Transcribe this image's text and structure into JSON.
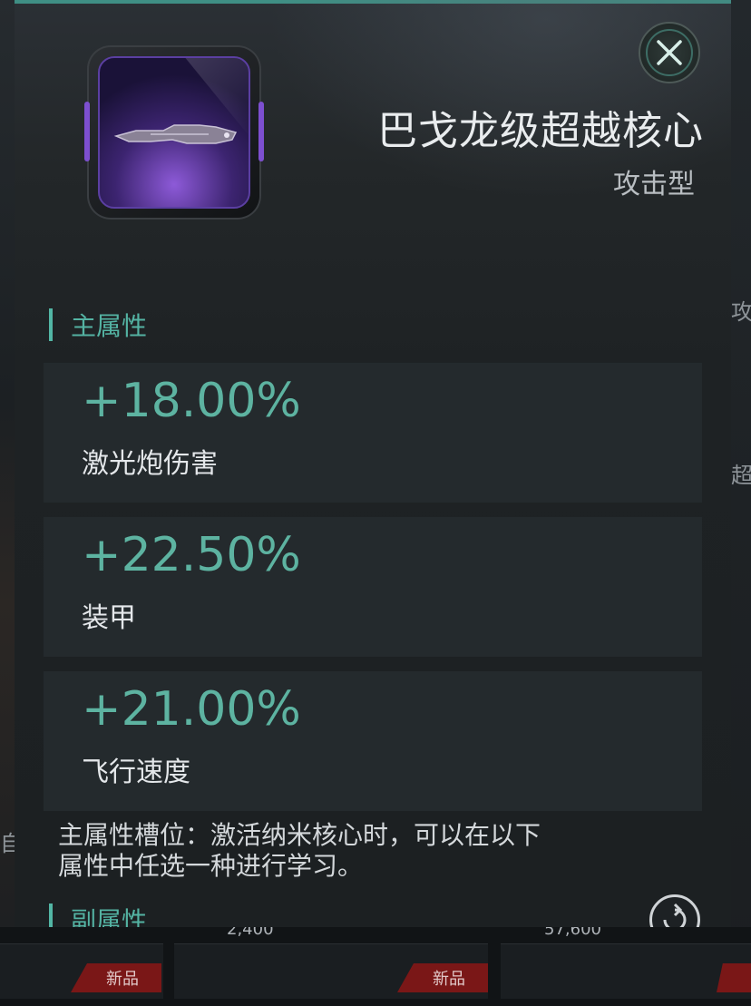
{
  "item": {
    "name": "巴戈龙级超越核心",
    "type": "攻击型"
  },
  "primary_section": {
    "label": "主属性",
    "stats": [
      {
        "value": "+18.00%",
        "name": "激光炮伤害"
      },
      {
        "value": "+22.50%",
        "name": "装甲"
      },
      {
        "value": "+21.00%",
        "name": "飞行速度"
      }
    ],
    "description_line1": "主属性槽位：激活纳米核心时，可以在以下",
    "description_line2": "属性中任选一种进行学习。"
  },
  "secondary_section": {
    "label": "副属性"
  },
  "background": {
    "right_glyph_1": "攻",
    "right_glyph_2": "超",
    "left_glyph": "自",
    "new_tag_label": "新品",
    "price_1": "2,400",
    "price_2": "57,600"
  },
  "colors": {
    "accent": "#54b3a3",
    "item_rarity": "#7d4fd0"
  },
  "icons": {
    "close": "close-icon",
    "refresh": "refresh-icon"
  }
}
